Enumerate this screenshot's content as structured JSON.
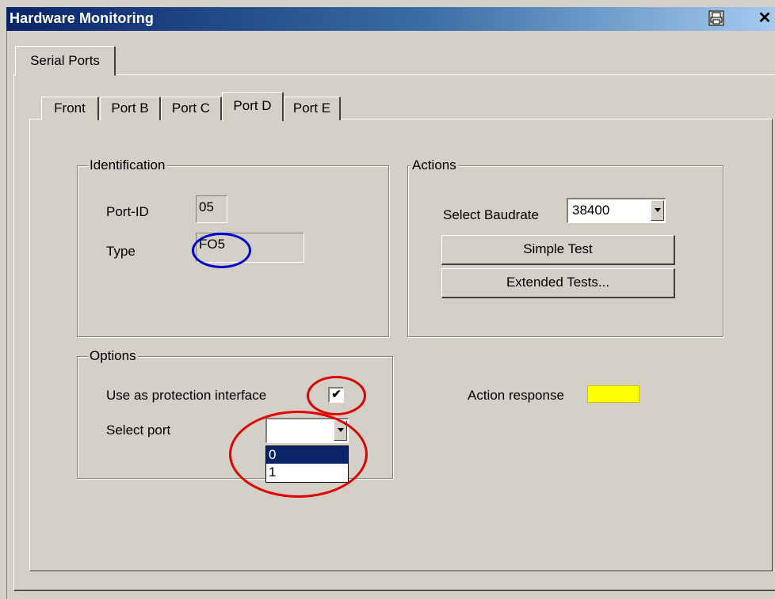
{
  "window": {
    "title": "Hardware Monitoring",
    "close_glyph": "✕"
  },
  "outer_tabs": [
    {
      "label": "Serial Ports",
      "active": true
    }
  ],
  "inner_tabs": [
    {
      "label": "Front"
    },
    {
      "label": "Port B"
    },
    {
      "label": "Port C"
    },
    {
      "label": "Port D",
      "active": true
    },
    {
      "label": "Port E"
    }
  ],
  "identification": {
    "legend": "Identification",
    "port_id_label": "Port-ID",
    "port_id_value": "05",
    "type_label": "Type",
    "type_value": "FO5"
  },
  "actions": {
    "legend": "Actions",
    "baudrate_label": "Select Baudrate",
    "baudrate_value": "38400",
    "simple_test_label": "Simple Test",
    "extended_tests_label": "Extended Tests..."
  },
  "options": {
    "legend": "Options",
    "protection_label": "Use as protection interface",
    "protection_checked": true,
    "check_glyph": "✔",
    "select_port_label": "Select port",
    "select_port_value": "",
    "port_options": [
      "0",
      "1"
    ],
    "highlighted_option": "0"
  },
  "action_response": {
    "label": "Action response",
    "color": "#ffff00"
  },
  "annotations": {
    "blue_circle_color": "#0000cc",
    "red_circle_color": "#e00000"
  }
}
